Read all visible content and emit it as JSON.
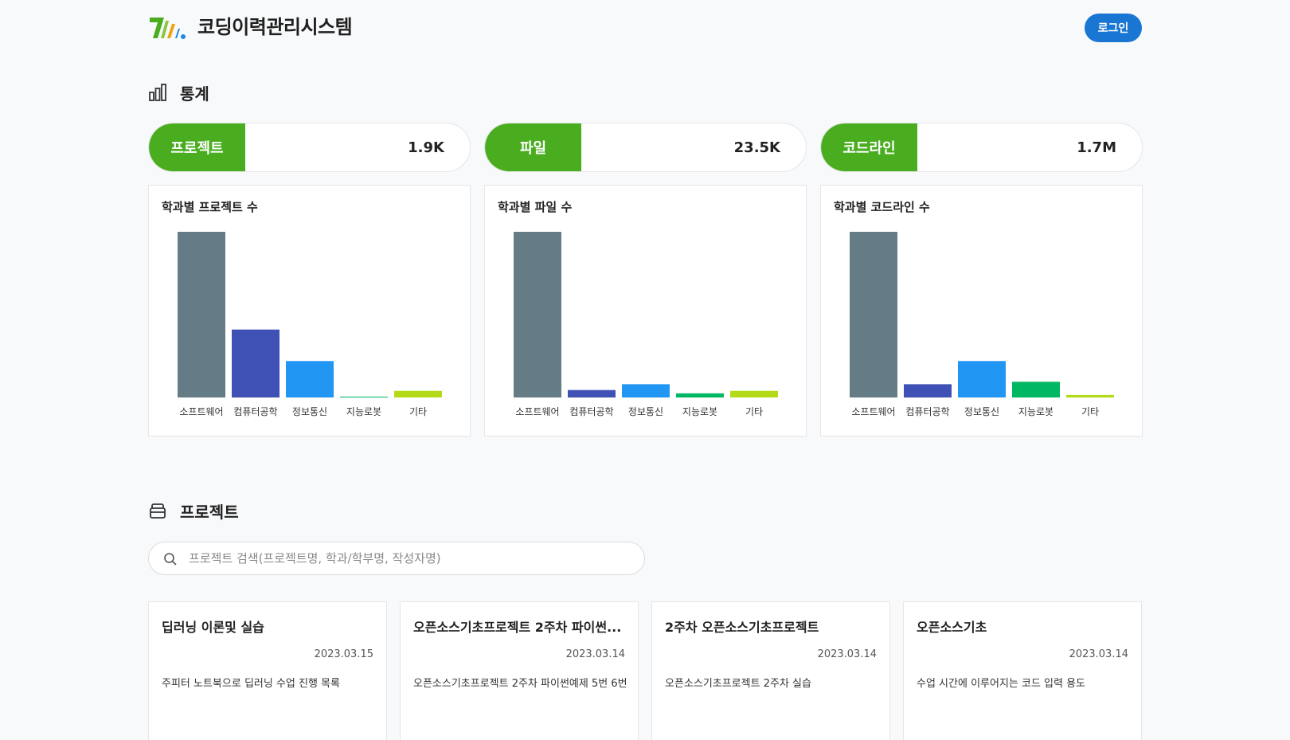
{
  "header": {
    "title": "코딩이력관리시스템",
    "login_label": "로그인",
    "brand_colors": [
      "#49ad1f",
      "#f2a20f",
      "#1e88e5"
    ]
  },
  "stats_section": {
    "title": "통계",
    "icon": "bar-chart-icon",
    "cards": [
      {
        "label": "프로젝트",
        "value": "1.9K"
      },
      {
        "label": "파일",
        "value": "23.5K"
      },
      {
        "label": "코드라인",
        "value": "1.7M"
      }
    ],
    "accent": "#49ad1f"
  },
  "chart_data": [
    {
      "type": "bar",
      "title": "학과별 프로젝트 수",
      "categories": [
        "소프트웨어",
        "컴퓨터공학",
        "정보통신",
        "지능로봇",
        "기타"
      ],
      "values": [
        100,
        41,
        22,
        0.5,
        4
      ],
      "colors": [
        "#657b86",
        "#3f51b5",
        "#2196f3",
        "#00b763",
        "#b4db18"
      ],
      "ylim": [
        0,
        100
      ],
      "grid": false
    },
    {
      "type": "bar",
      "title": "학과별 파일 수",
      "categories": [
        "소프트웨어",
        "컴퓨터공학",
        "정보통신",
        "지능로봇",
        "기타"
      ],
      "values": [
        100,
        4.5,
        8,
        2.5,
        4
      ],
      "colors": [
        "#657b86",
        "#3f51b5",
        "#2196f3",
        "#00b763",
        "#b4db18"
      ],
      "ylim": [
        0,
        100
      ],
      "grid": false
    },
    {
      "type": "bar",
      "title": "학과별 코드라인 수",
      "categories": [
        "소프트웨어",
        "컴퓨터공학",
        "정보통신",
        "지능로봇",
        "기타"
      ],
      "values": [
        100,
        8,
        22,
        9.5,
        1.5
      ],
      "colors": [
        "#657b86",
        "#3f51b5",
        "#2196f3",
        "#00b763",
        "#b4db18"
      ],
      "ylim": [
        0,
        100
      ],
      "grid": false
    }
  ],
  "projects_section": {
    "title": "프로젝트",
    "icon": "folder-stack-icon",
    "search_placeholder": "프로젝트 검색(프로젝트명, 학과/학부명, 작성자명)",
    "search_value": "",
    "items": [
      {
        "title": "딥러닝 이론및 실습",
        "date": "2023.03.15",
        "description": "주피터 노트북으로 딥러닝 수업 진행 목록"
      },
      {
        "title": "오픈소스기초프로젝트 2주차 파이썬...",
        "date": "2023.03.14",
        "description": "오픈소스기초프로젝트 2주차 파이썬예제 5번 6번"
      },
      {
        "title": "2주차 오픈소스기초프로젝트",
        "date": "2023.03.14",
        "description": "오픈소스기초프로젝트 2주차 실습"
      },
      {
        "title": "오픈소스기초",
        "date": "2023.03.14",
        "description": "수업 시간에 이루어지는 코드 입력 용도"
      }
    ]
  }
}
